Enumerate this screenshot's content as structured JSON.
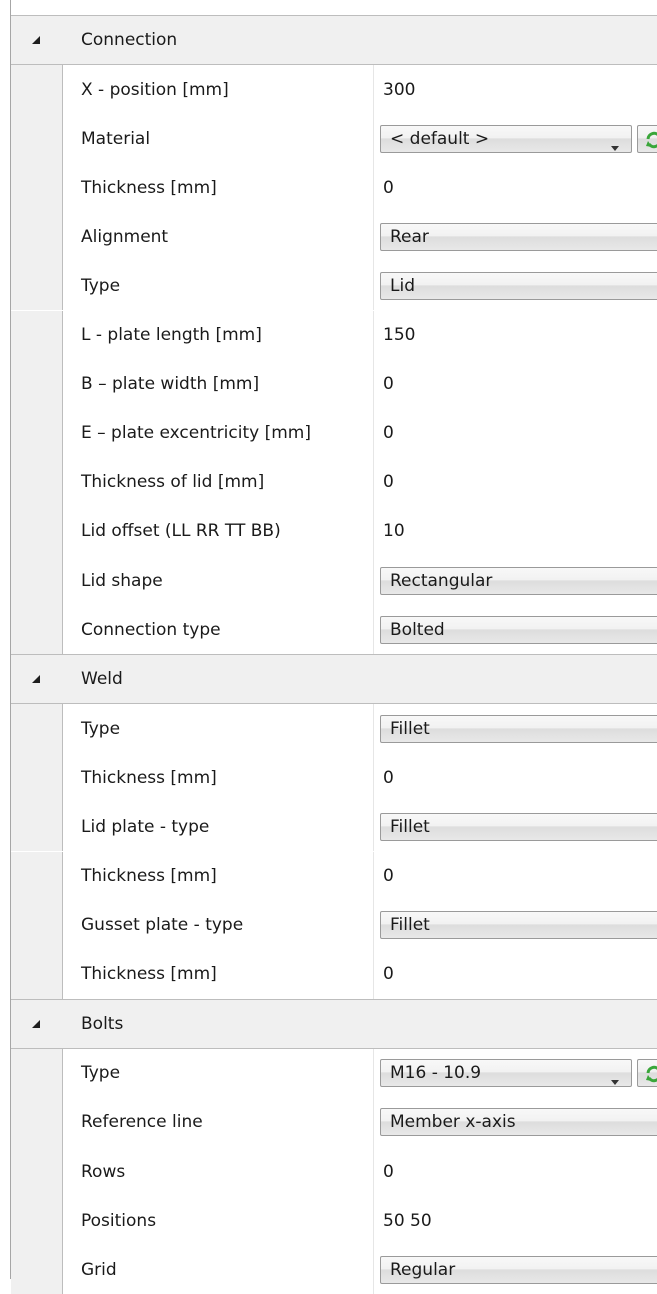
{
  "sections": [
    {
      "label": "Connection",
      "rows": [
        {
          "name": "X - position [mm]",
          "value": "300",
          "kind": "text"
        },
        {
          "name": "Material",
          "value": "< default >",
          "kind": "dropdown-refresh"
        },
        {
          "name": "Thickness [mm]",
          "value": "0",
          "kind": "text"
        },
        {
          "name": "Alignment",
          "value": "Rear",
          "kind": "dropdown"
        },
        {
          "name": "Type",
          "value": "Lid",
          "kind": "dropdown"
        },
        {
          "name": "L - plate length [mm]",
          "value": "150",
          "kind": "text"
        },
        {
          "name": "B – plate width [mm]",
          "value": "0",
          "kind": "text"
        },
        {
          "name": "E – plate excentricity [mm]",
          "value": "0",
          "kind": "text"
        },
        {
          "name": "Thickness of lid [mm]",
          "value": "0",
          "kind": "text"
        },
        {
          "name": "Lid offset (LL RR TT BB)",
          "value": "10",
          "kind": "text"
        },
        {
          "name": "Lid shape",
          "value": "Rectangular",
          "kind": "dropdown"
        },
        {
          "name": "Connection type",
          "value": "Bolted",
          "kind": "dropdown"
        }
      ]
    },
    {
      "label": "Weld",
      "rows": [
        {
          "name": "Type",
          "value": "Fillet",
          "kind": "dropdown"
        },
        {
          "name": "Thickness [mm]",
          "value": "0",
          "kind": "text"
        },
        {
          "name": "Lid plate - type",
          "value": "Fillet",
          "kind": "dropdown"
        },
        {
          "name": "Thickness [mm]",
          "value": "0",
          "kind": "text"
        },
        {
          "name": "Gusset plate - type",
          "value": "Fillet",
          "kind": "dropdown"
        },
        {
          "name": "Thickness [mm]",
          "value": "0",
          "kind": "text"
        }
      ]
    },
    {
      "label": "Bolts",
      "rows": [
        {
          "name": "Type",
          "value": "M16 - 10.9",
          "kind": "dropdown-refresh"
        },
        {
          "name": "Reference line",
          "value": "Member x-axis",
          "kind": "dropdown"
        },
        {
          "name": "Rows",
          "value": "0",
          "kind": "text"
        },
        {
          "name": "Positions",
          "value": "50 50",
          "kind": "text"
        },
        {
          "name": "Grid",
          "value": "Regular",
          "kind": "dropdown"
        }
      ]
    }
  ],
  "icons": {
    "collapse": "collapse-triangle-icon",
    "dropdown": "chevron-down-icon",
    "refresh": "refresh-icon"
  },
  "colors": {
    "category_background": "#f0f0f0",
    "refresh_icon": "#3aa63a"
  }
}
